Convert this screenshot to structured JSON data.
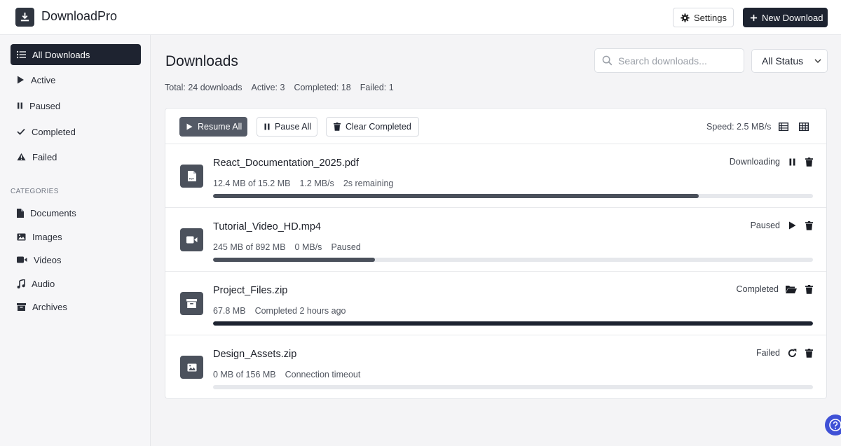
{
  "app": {
    "title": "DownloadPro"
  },
  "header": {
    "settings_label": "Settings",
    "new_download_label": "New Download"
  },
  "sidebar": {
    "items": [
      {
        "label": "All Downloads",
        "icon": "list-icon",
        "active": true
      },
      {
        "label": "Active",
        "icon": "play-icon",
        "active": false
      },
      {
        "label": "Paused",
        "icon": "pause-icon",
        "active": false
      },
      {
        "label": "Completed",
        "icon": "check-icon",
        "active": false
      },
      {
        "label": "Failed",
        "icon": "warning-icon",
        "active": false
      }
    ],
    "categories_heading": "CATEGORIES",
    "categories": [
      {
        "label": "Documents",
        "icon": "document-icon"
      },
      {
        "label": "Images",
        "icon": "image-icon"
      },
      {
        "label": "Videos",
        "icon": "video-icon"
      },
      {
        "label": "Audio",
        "icon": "music-icon"
      },
      {
        "label": "Archives",
        "icon": "archive-icon"
      }
    ]
  },
  "main": {
    "title": "Downloads",
    "search_placeholder": "Search downloads...",
    "status_filter": "All Status",
    "stats": {
      "total": "Total: 24 downloads",
      "active": "Active: 3",
      "completed": "Completed: 18",
      "failed": "Failed: 1"
    }
  },
  "toolbar": {
    "resume_all": "Resume All",
    "pause_all": "Pause All",
    "clear_completed": "Clear Completed",
    "speed": "Speed: 2.5 MB/s"
  },
  "downloads": [
    {
      "name": "React_Documentation_2025.pdf",
      "meta": [
        "12.4 MB of 15.2 MB",
        "1.2 MB/s",
        "2s remaining"
      ],
      "status": "Downloading",
      "progress": 0.81,
      "icon": "pdf-icon",
      "actions": [
        "pause-icon",
        "trash-icon"
      ]
    },
    {
      "name": "Tutorial_Video_HD.mp4",
      "meta": [
        "245 MB of 892 MB",
        "0 MB/s",
        "Paused"
      ],
      "status": "Paused",
      "progress": 0.27,
      "icon": "video-icon",
      "actions": [
        "play-icon",
        "trash-icon"
      ]
    },
    {
      "name": "Project_Files.zip",
      "meta": [
        "67.8 MB",
        "Completed 2 hours ago"
      ],
      "status": "Completed",
      "progress": 1.0,
      "icon": "archive-icon",
      "actions": [
        "folder-open-icon",
        "trash-icon"
      ]
    },
    {
      "name": "Design_Assets.zip",
      "meta": [
        "0 MB of 156 MB",
        "Connection timeout"
      ],
      "status": "Failed",
      "progress": 0.0,
      "icon": "image-icon",
      "actions": [
        "retry-icon",
        "trash-icon"
      ]
    }
  ],
  "colors": {
    "primary_dark": "#1d2330",
    "progress_fill": "#4a505b",
    "progress_complete": "#1d2330",
    "progress_track": "#e6e8ec",
    "help_button": "#3f51d6"
  }
}
